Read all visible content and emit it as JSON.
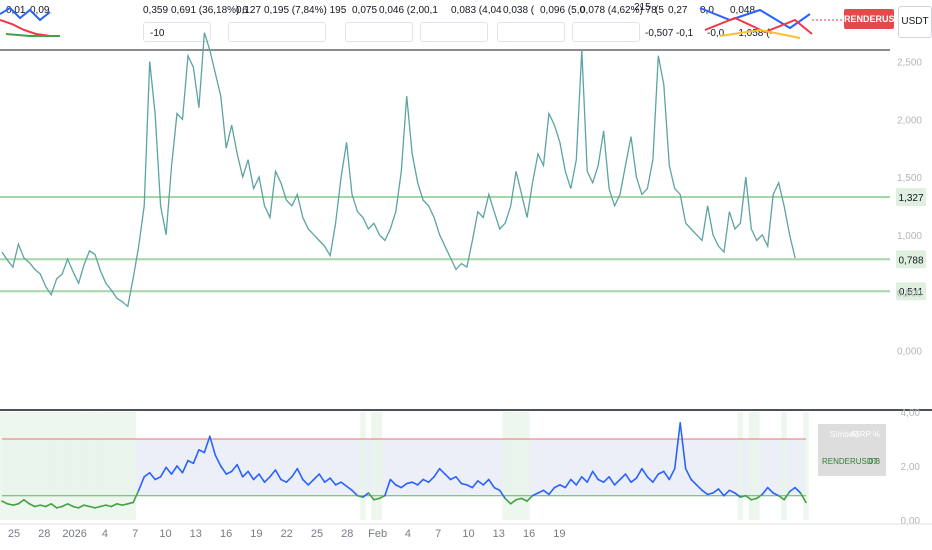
{
  "header": {
    "indicator_values": [
      "0,01",
      "0,09",
      "0,359",
      "0,691 (36,18%) 6",
      "0,127",
      "0,195 (7,84%) 195",
      "0,075",
      "0,046 (2,0",
      "0,1",
      "0,083 (4,04",
      "0,038 (",
      "0,096 (5,0",
      "0,078 (4,62%) 78",
      "215",
      "(5",
      "0,27",
      "0,0",
      "0,048"
    ],
    "second_row": [
      "-0,507",
      "-0,1",
      "-0,0",
      "-1,058 (-",
      "-10"
    ],
    "symbol": "RENDERUSDT",
    "currency": "USDT"
  },
  "colors": {
    "price_line": "#5da3a3",
    "atr_line": "#2962ff",
    "atr_low": "#43a047",
    "atr_high": "#f23645",
    "level_line": "#a5d6a7",
    "shading_green": "#e8f5e9",
    "band_fill": "#eceff7"
  },
  "chart_data": [
    {
      "type": "line",
      "series": [
        {
          "values": [
            0.85,
            0.78,
            0.72,
            0.92,
            0.8,
            0.76,
            0.7,
            0.66,
            0.55,
            0.48,
            0.62,
            0.66,
            0.79,
            0.68,
            0.58,
            0.74,
            0.86,
            0.83,
            0.69,
            0.58,
            0.52,
            0.45,
            0.42,
            0.38,
            0.63,
            0.9,
            1.25,
            2.5,
            2.05,
            1.25,
            1.0,
            1.6,
            2.05,
            2.0,
            2.55,
            2.45,
            2.1,
            2.75,
            2.6,
            2.4,
            2.2,
            1.75,
            1.95,
            1.7,
            1.5,
            1.65,
            1.4,
            1.5,
            1.25,
            1.15,
            1.55,
            1.45,
            1.3,
            1.25,
            1.35,
            1.15,
            1.05,
            1.0,
            0.95,
            0.9,
            0.82,
            1.1,
            1.5,
            1.8,
            1.35,
            1.2,
            1.15,
            1.05,
            1.1,
            1.0,
            0.95,
            1.05,
            1.2,
            1.55,
            2.2,
            1.7,
            1.45,
            1.3,
            1.25,
            1.15,
            1.0,
            0.9,
            0.8,
            0.7,
            0.75,
            0.72,
            0.95,
            1.2,
            1.15,
            1.35,
            1.2,
            1.05,
            1.1,
            1.25,
            1.55,
            1.35,
            1.15,
            1.45,
            1.7,
            1.6,
            2.05,
            1.95,
            1.8,
            1.55,
            1.4,
            1.65,
            2.6,
            1.55,
            1.45,
            1.6,
            1.9,
            1.4,
            1.25,
            1.35,
            1.6,
            1.85,
            1.5,
            1.35,
            1.4,
            1.65,
            2.55,
            2.3,
            1.6,
            1.4,
            1.35,
            1.1,
            1.05,
            1.0,
            0.95,
            1.25,
            1.0,
            0.9,
            0.85,
            1.2,
            1.05,
            1.1,
            1.5,
            1.05,
            0.95,
            1.0,
            0.9,
            1.35,
            1.45,
            1.25,
            1.0,
            0.8
          ]
        }
      ],
      "ylim": [
        -0.5,
        2.6
      ],
      "yticks": [
        "2,500",
        "2,000",
        "1,500",
        "1,000",
        "0,500",
        "0,000"
      ],
      "ytick_values": [
        2.5,
        2.0,
        1.5,
        1.0,
        0.5,
        0.0
      ],
      "levels": [
        {
          "value": 1.327,
          "label": "1,327"
        },
        {
          "value": 0.788,
          "label": "0,788"
        },
        {
          "value": 0.511,
          "label": "0,511"
        }
      ],
      "grid": false
    },
    {
      "type": "line",
      "series": [
        {
          "values": [
            0.7,
            0.6,
            0.55,
            0.6,
            0.75,
            0.6,
            0.5,
            0.55,
            0.5,
            0.6,
            0.45,
            0.5,
            0.6,
            0.5,
            0.45,
            0.55,
            0.5,
            0.45,
            0.5,
            0.55,
            0.5,
            0.6,
            0.55,
            0.6,
            0.65,
            1.1,
            1.6,
            1.75,
            1.5,
            1.6,
            1.95,
            1.7,
            2.0,
            1.75,
            2.2,
            2.1,
            2.6,
            2.5,
            3.1,
            2.4,
            2.0,
            1.7,
            1.8,
            2.05,
            1.6,
            1.8,
            1.5,
            1.7,
            1.4,
            1.6,
            1.85,
            1.5,
            1.4,
            1.6,
            1.9,
            1.5,
            1.3,
            1.5,
            1.7,
            1.4,
            1.55,
            1.3,
            1.4,
            1.25,
            1.1,
            0.9,
            0.85,
            1.0,
            0.75,
            0.8,
            0.9,
            1.5,
            1.3,
            1.2,
            1.35,
            1.4,
            1.3,
            1.5,
            1.4,
            1.6,
            1.9,
            1.7,
            1.5,
            1.6,
            1.35,
            1.3,
            1.2,
            1.45,
            1.3,
            1.5,
            1.2,
            1.1,
            0.8,
            0.6,
            0.75,
            0.8,
            0.7,
            0.9,
            1.0,
            1.1,
            0.95,
            1.2,
            1.3,
            1.2,
            1.5,
            1.3,
            1.6,
            1.4,
            1.8,
            1.5,
            1.4,
            1.6,
            1.3,
            1.5,
            1.7,
            1.4,
            1.55,
            1.9,
            1.6,
            1.4,
            1.7,
            1.8,
            1.5,
            1.9,
            3.6,
            1.9,
            1.5,
            1.3,
            1.1,
            0.95,
            1.0,
            1.15,
            0.9,
            1.1,
            1.0,
            0.85,
            0.9,
            0.75,
            0.8,
            0.95,
            1.2,
            1.0,
            0.9,
            0.75,
            1.05,
            1.2,
            1.0,
            0.65
          ]
        }
      ],
      "ylim": [
        0,
        4.0
      ],
      "yticks": [
        "4,00",
        "2,00",
        "0,00"
      ],
      "ytick_values": [
        4.0,
        2.0,
        0.0
      ],
      "threshold_high": 3.0,
      "threshold_low": 0.9,
      "x_tick_labels": [
        "25",
        "28",
        "2026",
        "4",
        "7",
        "10",
        "13",
        "16",
        "19",
        "22",
        "25",
        "28",
        "Feb",
        "4",
        "7",
        "10",
        "13",
        "16",
        "19"
      ],
      "table": {
        "headers": [
          "Símbolo",
          "ATRP %"
        ],
        "rows": [
          [
            "RENDERUSDT",
            "0.8"
          ]
        ]
      }
    }
  ]
}
